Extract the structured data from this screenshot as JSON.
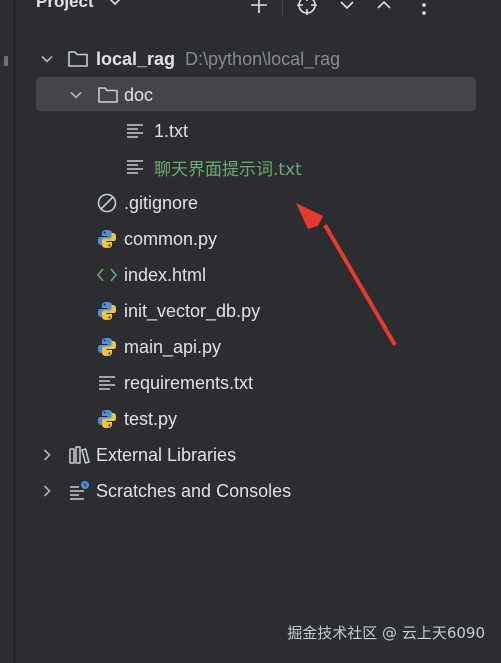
{
  "panel": {
    "title": "Project"
  },
  "tree": {
    "root": {
      "name": "local_rag",
      "path": "D:\\python\\local_rag"
    },
    "doc": {
      "name": "doc"
    },
    "files_doc": [
      {
        "name": "1.txt"
      },
      {
        "name": "聊天界面提示词.txt"
      }
    ],
    "files": [
      {
        "name": ".gitignore"
      },
      {
        "name": "common.py"
      },
      {
        "name": "index.html"
      },
      {
        "name": "init_vector_db.py"
      },
      {
        "name": "main_api.py"
      },
      {
        "name": "requirements.txt"
      },
      {
        "name": "test.py"
      }
    ],
    "external": {
      "name": "External Libraries"
    },
    "scratches": {
      "name": "Scratches and Consoles"
    }
  },
  "watermark": "掘金技术社区 @ 云上天6090",
  "colors": {
    "background": "#2b2d30",
    "selection": "#43454a",
    "modified_file": "#6aab73",
    "arrow": "#e8392e"
  }
}
